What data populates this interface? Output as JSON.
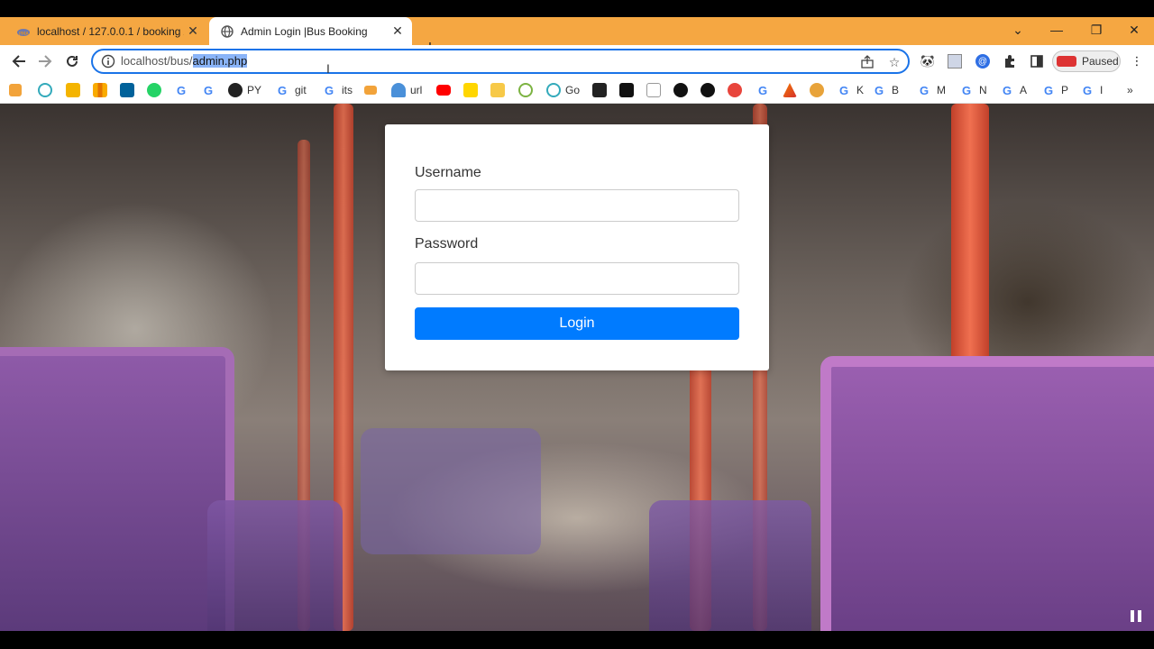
{
  "tabs": [
    {
      "title": "localhost / 127.0.0.1 / booking / ",
      "favicon": "phpmyadmin-icon",
      "active": false
    },
    {
      "title": "Admin Login |Bus Booking",
      "favicon": "globe-icon",
      "active": true
    }
  ],
  "window_controls": {
    "dropdown": "∨",
    "minimize": "—",
    "restore": "⧉",
    "close": "✕"
  },
  "omnibox": {
    "host": "localhost/bus/",
    "path_selected": "admin.php"
  },
  "profile": {
    "label": "Paused"
  },
  "bookmarks": [
    {
      "label": "",
      "icon": "phpmyadmin-icon"
    },
    {
      "label": "",
      "icon": "replit-icon"
    },
    {
      "label": "",
      "icon": "notebook-icon"
    },
    {
      "label": "",
      "icon": "analytics-icon"
    },
    {
      "label": "",
      "icon": "ieee-icon"
    },
    {
      "label": "",
      "icon": "whatsapp-icon"
    },
    {
      "label": "",
      "icon": "google-icon"
    },
    {
      "label": "",
      "icon": "google-icon"
    },
    {
      "label": "PY",
      "icon": "github-icon"
    },
    {
      "label": "git",
      "icon": "google-icon"
    },
    {
      "label": "its",
      "icon": "google-icon"
    },
    {
      "label": "",
      "icon": "phpmyadmin-icon"
    },
    {
      "label": "url",
      "icon": "cloud-icon"
    },
    {
      "label": "",
      "icon": "youtube-icon"
    },
    {
      "label": "",
      "icon": "p-icon"
    },
    {
      "label": "",
      "icon": "folder-icon"
    },
    {
      "label": "",
      "icon": "circle-icon"
    },
    {
      "label": "Go",
      "icon": "replit-icon"
    },
    {
      "label": "",
      "icon": "person-icon"
    },
    {
      "label": "",
      "icon": "cl-icon"
    },
    {
      "label": "",
      "icon": "runner-icon"
    },
    {
      "label": "",
      "icon": "soccer-icon"
    },
    {
      "label": "",
      "icon": "soccer-icon"
    },
    {
      "label": "",
      "icon": "g-red-icon"
    },
    {
      "label": "",
      "icon": "google-icon"
    },
    {
      "label": "",
      "icon": "triangle-icon"
    },
    {
      "label": "",
      "icon": "eye-icon"
    },
    {
      "label": "K",
      "icon": "google-icon"
    },
    {
      "label": "B",
      "icon": "google-icon"
    },
    {
      "label": "M",
      "icon": "google-icon"
    },
    {
      "label": "N",
      "icon": "google-icon"
    },
    {
      "label": "A",
      "icon": "google-icon"
    },
    {
      "label": "P",
      "icon": "google-icon"
    },
    {
      "label": "I",
      "icon": "google-icon"
    }
  ],
  "form": {
    "username_label": "Username",
    "username_value": "",
    "password_label": "Password",
    "password_value": "",
    "login_label": "Login"
  },
  "colors": {
    "tabstrip": "#f5a742",
    "accent": "#007bff",
    "omnibox_border": "#1a73e8"
  }
}
